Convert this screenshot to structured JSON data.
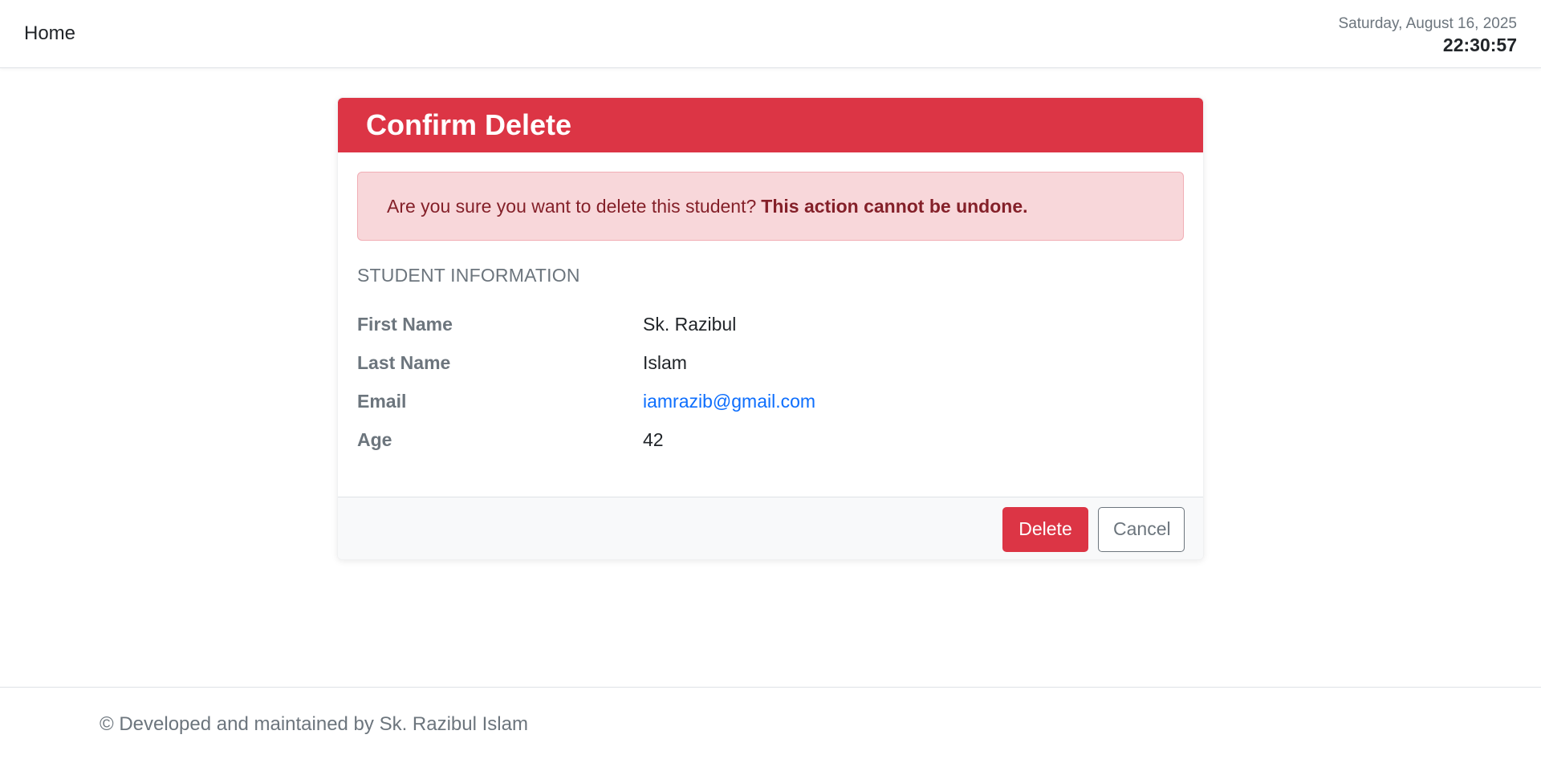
{
  "navbar": {
    "home_label": "Home",
    "date": "Saturday, August 16, 2025",
    "time": "22:30:57"
  },
  "card": {
    "title": "Confirm Delete",
    "alert": {
      "message": "Are you sure you want to delete this student?",
      "warning": "This action cannot be undone."
    },
    "section_title": "STUDENT INFORMATION",
    "fields": [
      {
        "label": "First Name",
        "value": "Sk. Razibul"
      },
      {
        "label": "Last Name",
        "value": "Islam"
      },
      {
        "label": "Email",
        "value": "iamrazib@gmail.com"
      },
      {
        "label": "Age",
        "value": "42"
      }
    ],
    "delete_label": "Delete",
    "cancel_label": "Cancel"
  },
  "footer": {
    "text": "© Developed and maintained by Sk. Razibul Islam"
  },
  "colors": {
    "danger": "#dc3545",
    "alert_bg": "#f8d7da",
    "alert_text": "#842029",
    "link": "#0d6efd",
    "muted": "#6c757d"
  }
}
